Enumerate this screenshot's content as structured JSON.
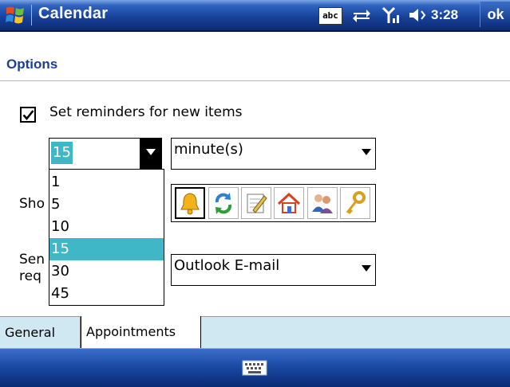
{
  "titlebar": {
    "app_title": "Calendar",
    "input_indicator": "abc",
    "clock": "3:28",
    "ok_label": "ok",
    "icons": [
      "windows-start-icon",
      "connectivity-icon",
      "signal-icon",
      "volume-icon"
    ]
  },
  "page": {
    "title": "Options"
  },
  "reminders": {
    "checkbox_label": "Set reminders for new items",
    "checked": true,
    "quantity_value": "15",
    "unit_value": "minute(s)",
    "dropdown_options": [
      "1",
      "5",
      "10",
      "15",
      "30",
      "45"
    ],
    "dropdown_selected": "15"
  },
  "show_icons": {
    "label_partial": "Sho",
    "icons": [
      "bell-icon",
      "recurrence-icon",
      "notes-icon",
      "home-icon",
      "attendees-icon",
      "key-icon"
    ]
  },
  "send_requests": {
    "label_line1_partial": "Sen",
    "label_line2_partial": "req",
    "value": "Outlook E-mail"
  },
  "tabs": [
    "General",
    "Appointments"
  ],
  "active_tab": "Appointments",
  "colors": {
    "title_bar_dark": "#0d2b72",
    "title_bar_light": "#7aa6e6",
    "page_title_color": "#1c3f94",
    "selection_cyan": "#3fb7c7",
    "tab_bar_bg": "#cfe8f2"
  }
}
